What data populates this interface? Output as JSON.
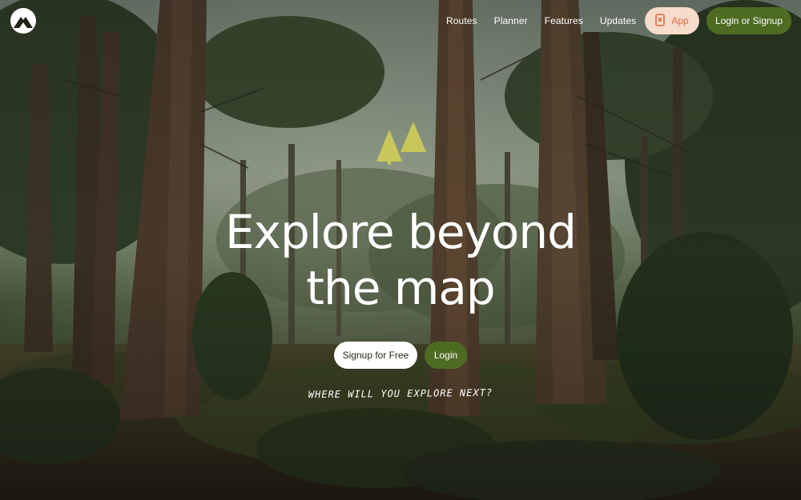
{
  "colors": {
    "brand_green": "#4e6b22",
    "app_button_bg": "#f6dccb",
    "app_button_text": "#e46a42",
    "mark_yellow": "#c8c75a"
  },
  "header": {
    "logo_icon": "mountain-logo-icon",
    "nav": [
      {
        "label": "Routes"
      },
      {
        "label": "Planner"
      },
      {
        "label": "Features"
      },
      {
        "label": "Updates"
      }
    ],
    "app_button": {
      "label": "App",
      "icon": "phone-icon"
    },
    "login_signup_label": "Login or Signup"
  },
  "hero": {
    "background": "forest-photo",
    "mark_icon": "twin-trees-icon",
    "title_line1": "Explore beyond",
    "title_line2": "the map",
    "signup_label": "Signup for Free",
    "login_label": "Login",
    "tagline": "WHERE WILL YOU EXPLORE NEXT?"
  }
}
